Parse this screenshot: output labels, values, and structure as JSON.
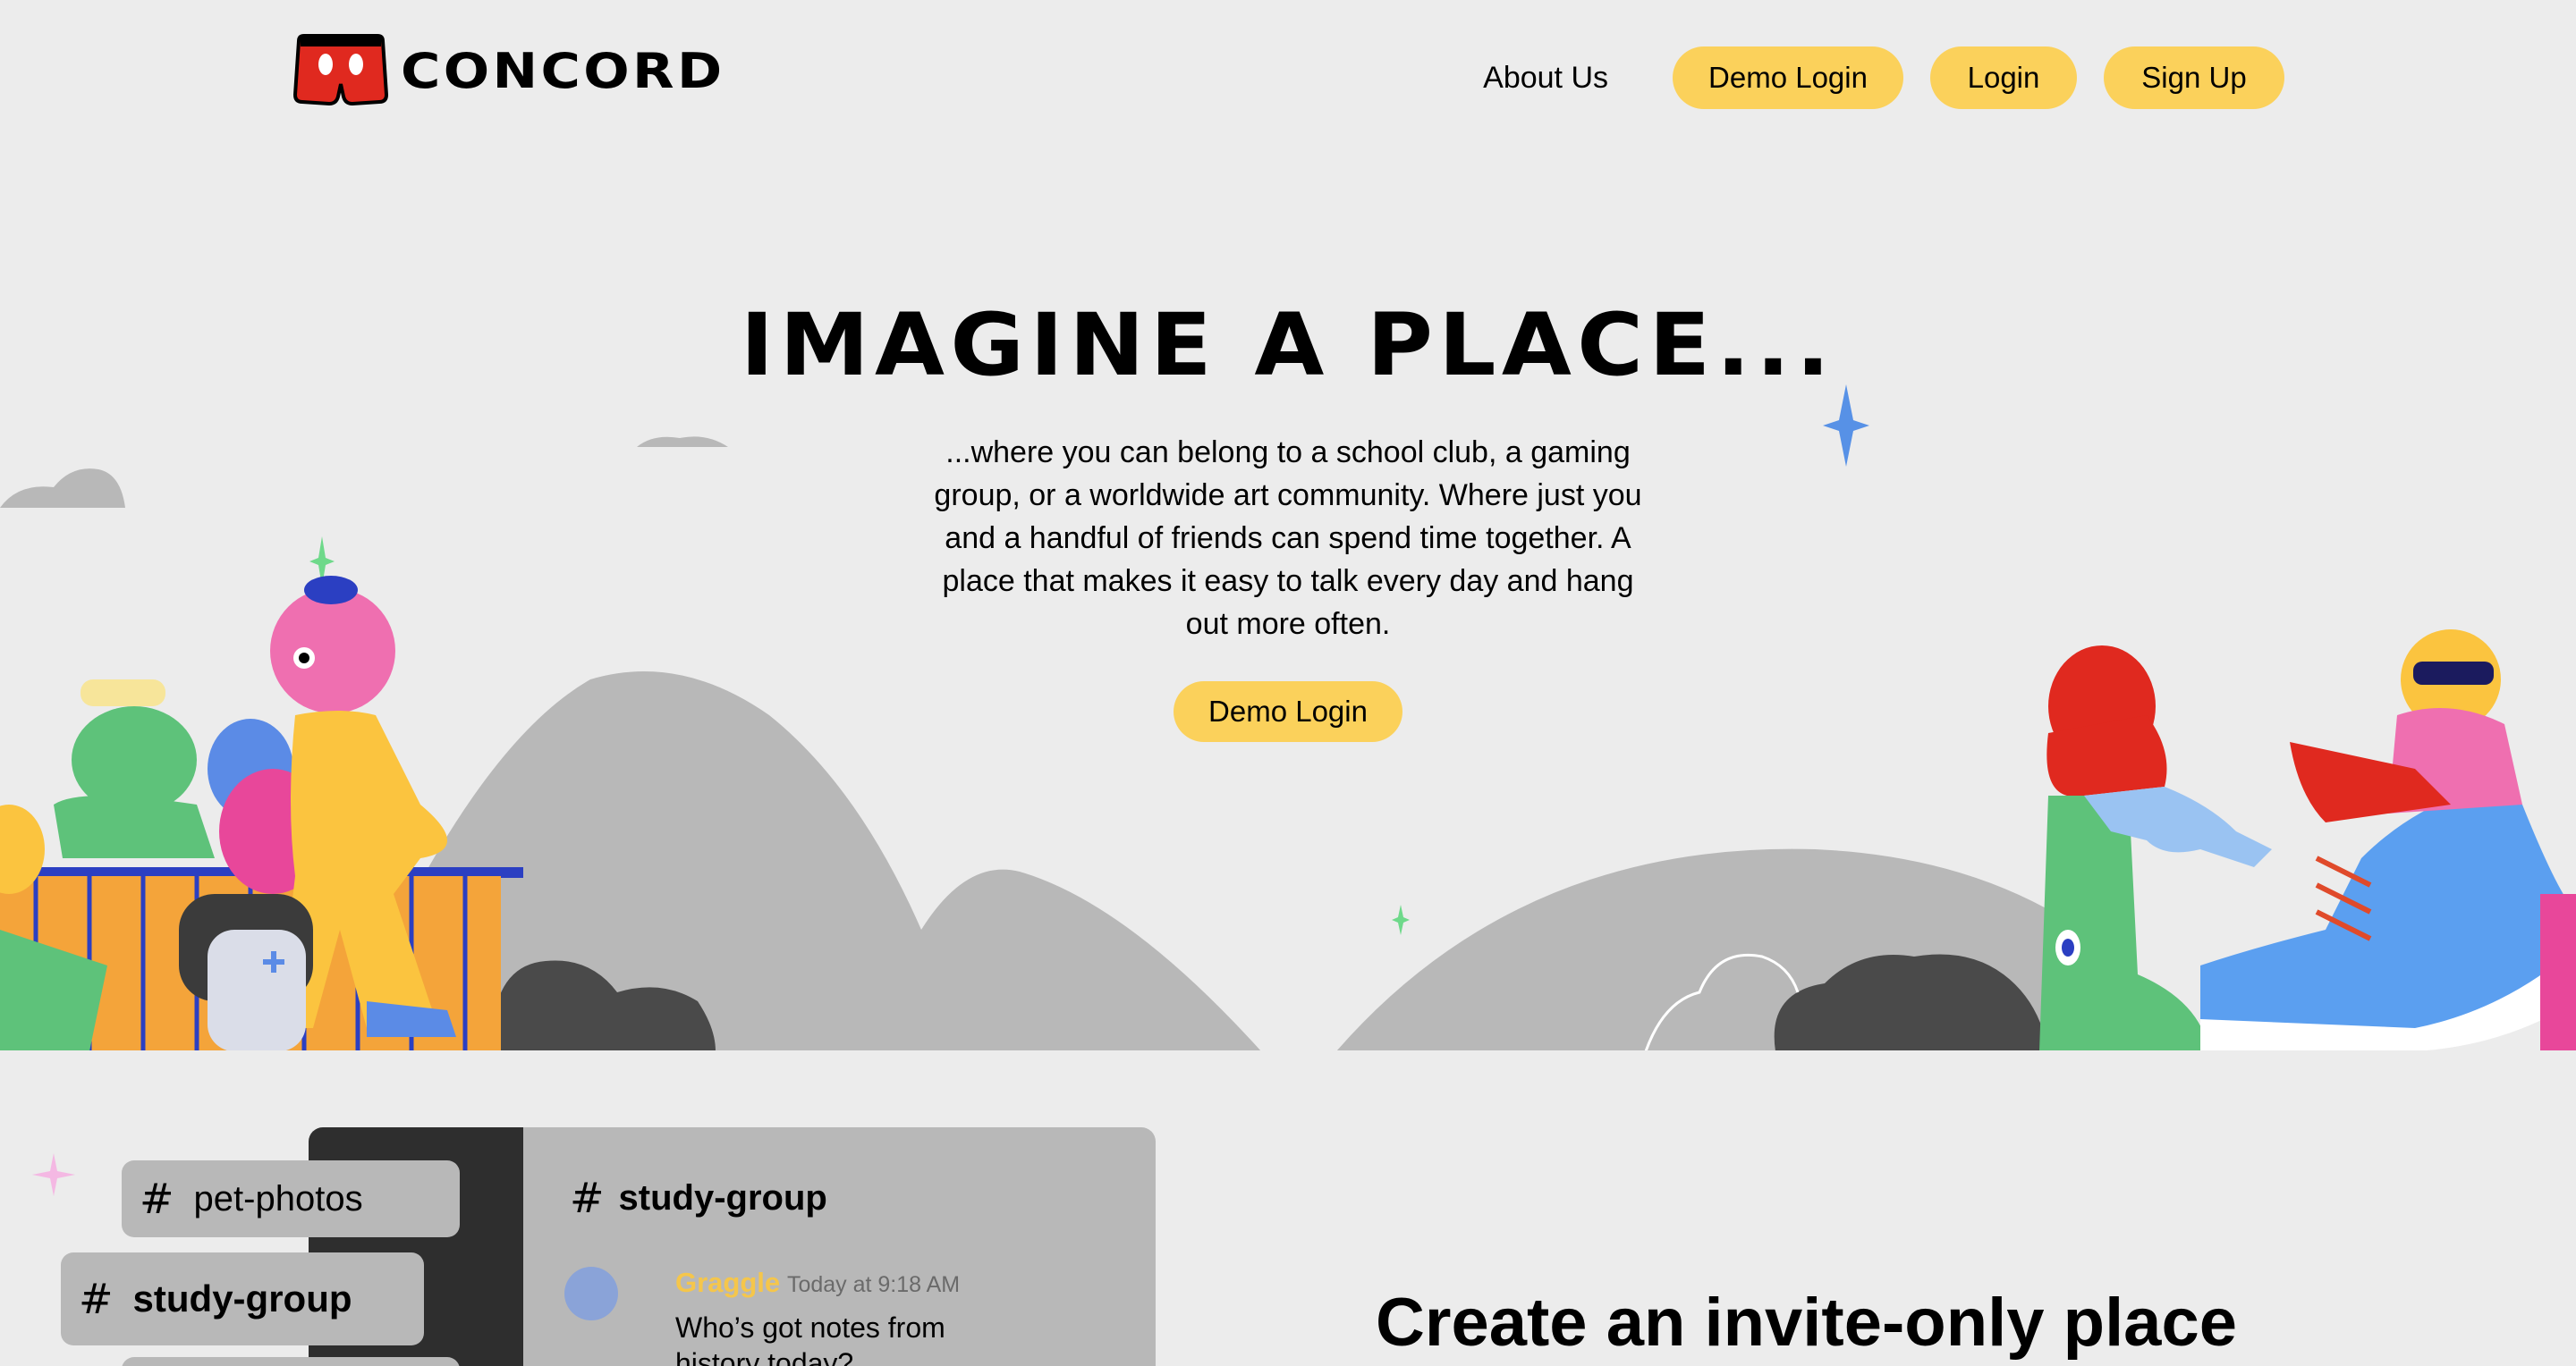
{
  "brand": {
    "name": "CONCORD",
    "logo_icon": "shorts-logo-icon",
    "logo_color": "#e0291f"
  },
  "nav": {
    "about": "About Us",
    "demo_login": "Demo Login",
    "login": "Login",
    "signup": "Sign Up"
  },
  "hero": {
    "title": "IMAGINE A PLACE...",
    "text": "...where you can belong to a school club, a gaming group, or a worldwide art community. Where just you and a handful of friends can spend time together. A place that makes it easy to talk every day and hang out more often.",
    "cta": "Demo Login"
  },
  "showcase": {
    "channels": [
      "pet-photos",
      "study-group"
    ],
    "panel_title": "study-group",
    "message": {
      "author": "Graggle",
      "time": "Today at 9:18 AM",
      "body": "Who’s got notes from history today?"
    },
    "heading": "Create an invite-only place"
  },
  "colors": {
    "accent": "#fbd15b",
    "background": "#ececec",
    "hill": "#b8b8b8",
    "dark": "#2e2e2e"
  }
}
